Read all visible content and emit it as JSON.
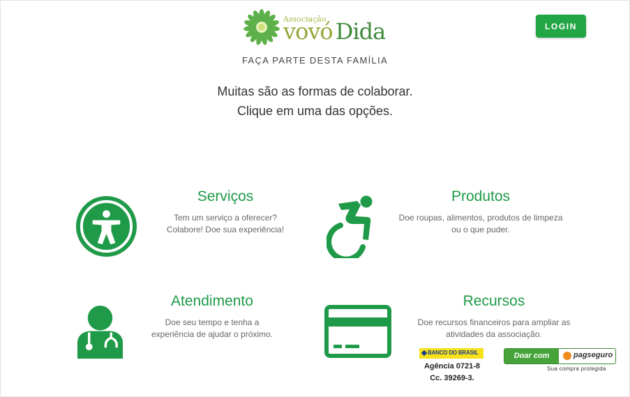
{
  "header": {
    "logo": {
      "small_text": "Associação",
      "name_part1": "vovó",
      "name_part2": "Dida"
    },
    "login_label": "LOGIN",
    "tagline": "FAÇA PARTE DESTA FAMÍLIA"
  },
  "intro": {
    "line1": "Muitas são as formas de colaborar.",
    "line2": "Clique em uma das opções."
  },
  "options": {
    "servicos": {
      "title": "Serviços",
      "line1": "Tem um serviço a oferecer?",
      "line2": "Colabore! Doe sua experiência!",
      "icon": "accessibility-icon"
    },
    "produtos": {
      "title": "Produtos",
      "line1": "Doe roupas, alimentos, produtos de limpeza",
      "line2": "ou o que puder.",
      "icon": "wheelchair-icon"
    },
    "atendimento": {
      "title": "Atendimento",
      "line1": "Doe seu tempo e tenha a",
      "line2": "experiência de ajudar o próximo.",
      "icon": "doctor-icon"
    },
    "recursos": {
      "title": "Recursos",
      "line1": "Doe recursos financeiros para ampliar as",
      "line2": "atividades da associação.",
      "icon": "credit-card-icon"
    }
  },
  "donation": {
    "bank_name": "BANCO DO BRASIL",
    "agency": "Agência 0721-8",
    "account": "Cc. 39269-3.",
    "pagseguro_button": "Doar com",
    "pagseguro_brand": "pagseguro",
    "pagseguro_caption": "Sua compra protegida"
  },
  "colors": {
    "accent": "#22a544",
    "heading": "#1f9a48",
    "logo_light": "#93a83a",
    "logo_dark": "#3f8a3a"
  }
}
